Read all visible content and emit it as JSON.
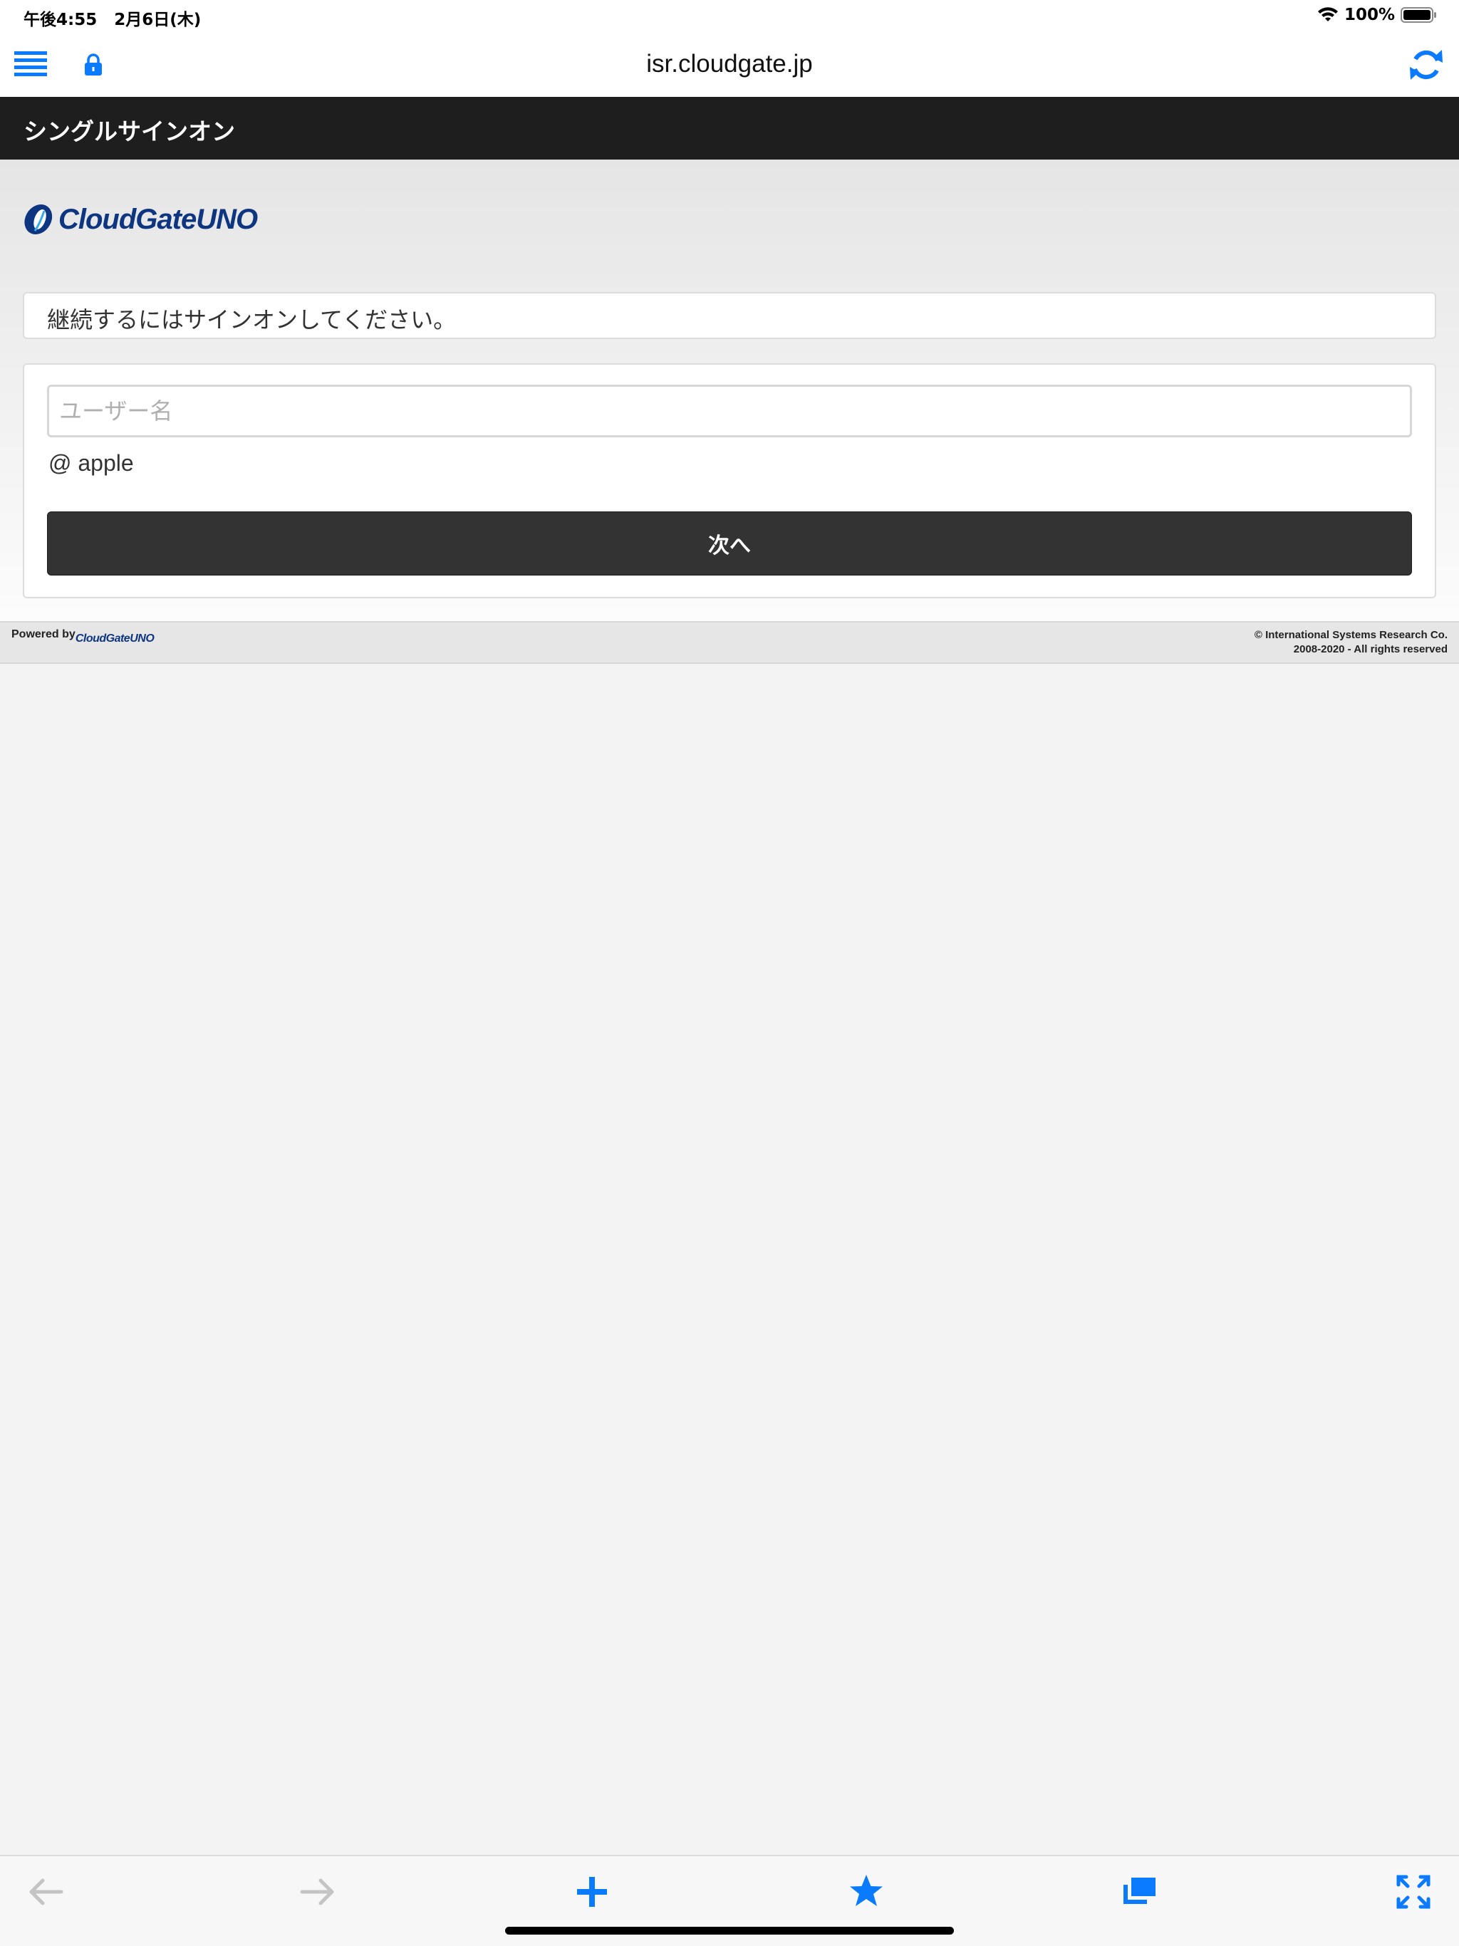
{
  "status_bar": {
    "time": "午後4:55",
    "date": "2月6日(木)",
    "battery": "100%"
  },
  "browser": {
    "url": "isr.cloudgate.jp"
  },
  "header": {
    "title": "シングルサインオン"
  },
  "logo": {
    "text": "CloudGateUNO"
  },
  "signin": {
    "message": "継続するにはサインオンしてください。",
    "username_placeholder": "ユーザー名",
    "username_value": "",
    "domain": "@ apple",
    "next_label": "次へ"
  },
  "footer": {
    "powered_by": "Powered by",
    "powered_logo": "CloudGateUNO",
    "copyright_line1": "© International Systems Research Co.",
    "copyright_line2": "2008-2020 - All rights reserved"
  },
  "toolbar": {
    "icons": [
      "back-arrow-icon",
      "forward-arrow-icon",
      "plus-icon",
      "star-icon",
      "tabs-icon",
      "fullscreen-icon"
    ]
  },
  "colors": {
    "accent": "#0a7aff",
    "header_bg": "#1e1e1e",
    "button_bg": "#333333",
    "logo_blue": "#0d3580",
    "disabled_gray": "#c4c4c4"
  }
}
